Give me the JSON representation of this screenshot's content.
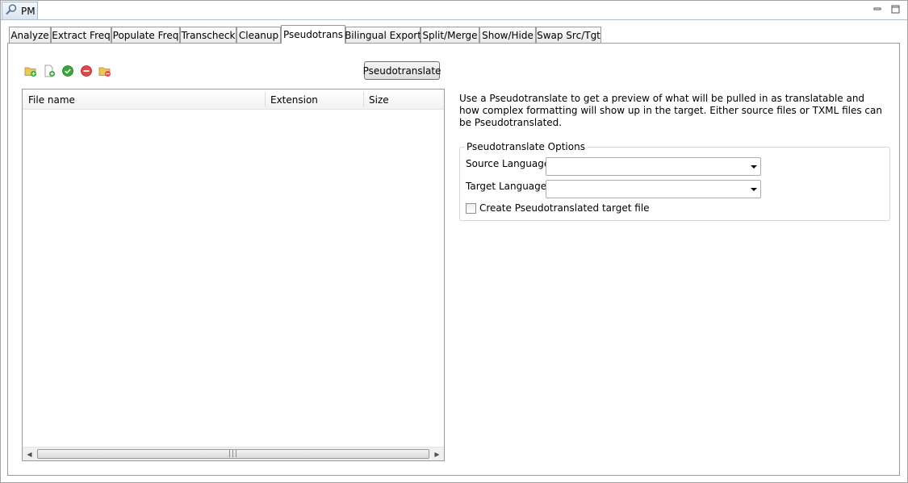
{
  "view": {
    "title": "PM",
    "minimize_icon": "minimize-icon",
    "maximize_icon": "maximize-icon"
  },
  "tabs": [
    {
      "label": "Analyze"
    },
    {
      "label": "Extract Freq"
    },
    {
      "label": "Populate Freq"
    },
    {
      "label": "Transcheck"
    },
    {
      "label": "Cleanup"
    },
    {
      "label": "Pseudotrans",
      "active": true
    },
    {
      "label": "Bilingual Export"
    },
    {
      "label": "Split/Merge"
    },
    {
      "label": "Show/Hide"
    },
    {
      "label": "Swap Src/Tgt"
    }
  ],
  "toolbar": {
    "icons": [
      "add-folder-icon",
      "add-file-icon",
      "select-all-icon",
      "remove-icon",
      "remove-folder-icon"
    ],
    "action_label": "Pseudotranslate"
  },
  "file_table": {
    "columns": [
      "File name",
      "Extension",
      "Size"
    ],
    "rows": []
  },
  "description": "Use a Pseudotranslate to get a preview of what will be pulled in as translatable and how complex formatting will show up in the target. Either source files or TXML files can be Pseudotranslated.",
  "options": {
    "group_title": "Pseudotranslate Options",
    "source_language_label": "Source Language:",
    "source_language_value": "",
    "target_language_label": "Target Language:",
    "target_language_value": "",
    "create_target_label": "Create Pseudotranslated target file",
    "create_target_checked": false
  },
  "colors": {
    "accent_green": "#3aa63a",
    "accent_red": "#e04848",
    "folder_yellow": "#e8c85a"
  }
}
